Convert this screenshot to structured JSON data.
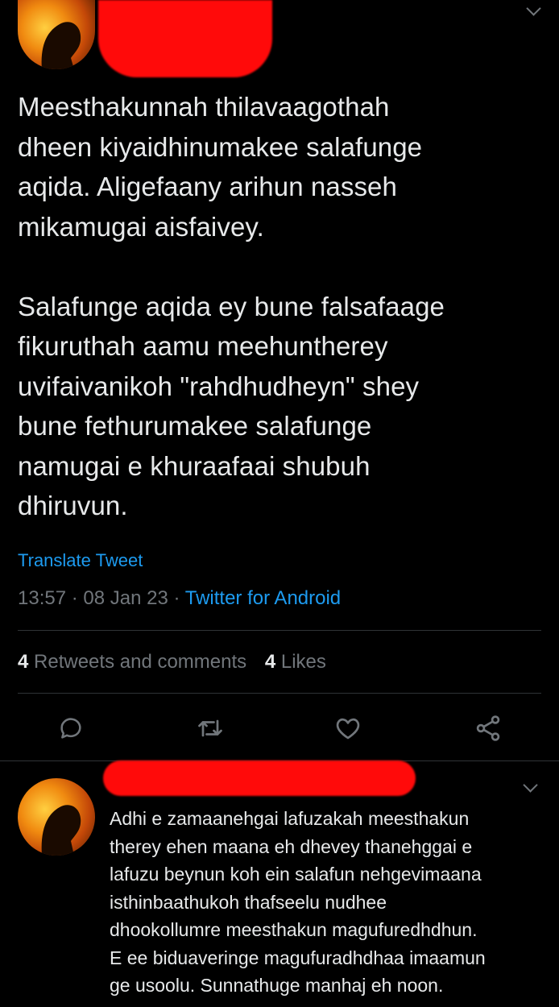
{
  "tweet": {
    "text": "Meesthakunnah thilavaagothah\ndheen kiyaidhinumakee salafunge\naqida. Aligefaany arihun nasseh\nmikamugai aisfaivey.\n\nSalafunge aqida ey bune falsafaage\nfikuruthah aamu meehuntherey\nuvifaivanikoh \"rahdhudheyn\" shey\nbune fethurumakee salafunge\nnamugai e khuraafaai shubuh\ndhiruvun.",
    "translate_label": "Translate Tweet",
    "time": "13:57",
    "date": "08 Jan 23",
    "separator": "·",
    "source": "Twitter for Android",
    "retweets_count": "4",
    "retweets_label": "Retweets and comments",
    "likes_count": "4",
    "likes_label": "Likes"
  },
  "actions": {
    "reply_icon": "comment-icon",
    "retweet_icon": "retweet-icon",
    "like_icon": "heart-icon",
    "share_icon": "share-icon"
  },
  "reply": {
    "text": "Adhi e zamaanehgai lafuzakah meesthakun\ntherey ehen maana eh dhevey thanehggai e\nlafuzu beynun koh ein salafun nehgevimaana\nisthinbaathukoh thafseelu nudhee\ndhookollumre meesthakun magufuredhdhun.\nE ee biduaveringe magufuradhdhaa imaamun\nge usoolu. Sunnathuge manhaj eh noon."
  },
  "colors": {
    "background": "#000000",
    "text": "#e7e9ea",
    "accent": "#1d9bf0",
    "muted": "#71767b",
    "redaction": "#ff0a0a"
  }
}
